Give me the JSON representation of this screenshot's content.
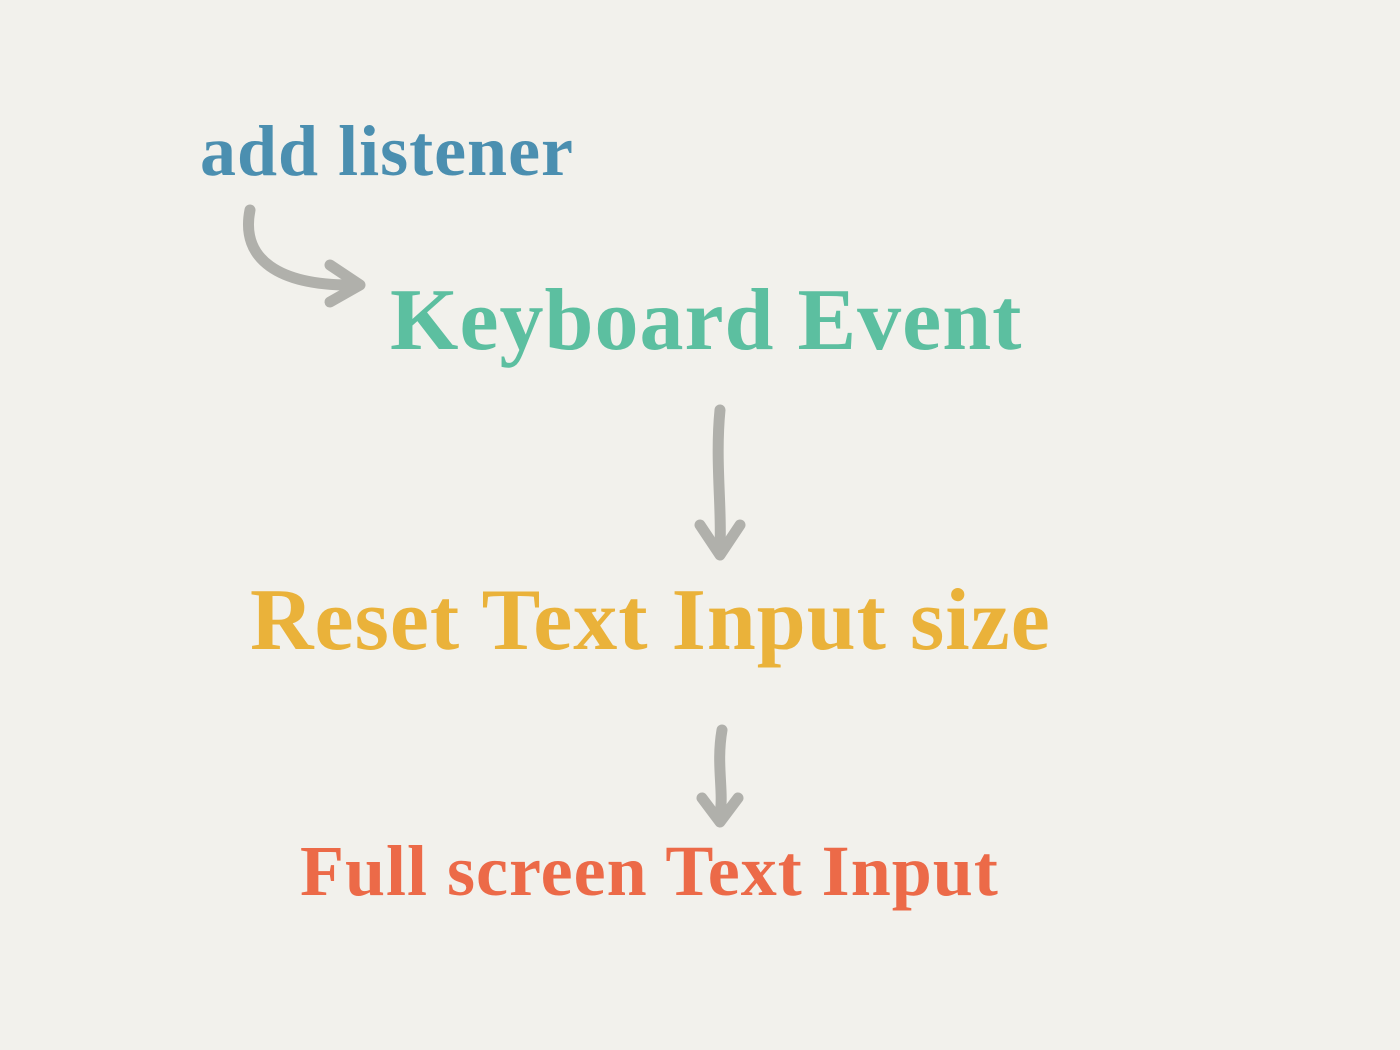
{
  "flow": {
    "nodes": [
      {
        "id": "add-listener",
        "label": "add listener",
        "color": "#4b8fb0"
      },
      {
        "id": "keyboard-event",
        "label": "Keyboard Event",
        "color": "#5cbfa0"
      },
      {
        "id": "reset-text-input",
        "label": "Reset Text Input size",
        "color": "#eab23a"
      },
      {
        "id": "fullscreen-text-input",
        "label": "Full screen Text Input",
        "color": "#ec6a48"
      }
    ],
    "edges": [
      {
        "from": "add-listener",
        "to": "keyboard-event"
      },
      {
        "from": "keyboard-event",
        "to": "reset-text-input"
      },
      {
        "from": "reset-text-input",
        "to": "fullscreen-text-input"
      }
    ],
    "arrow_color": "#b0b0ab"
  }
}
